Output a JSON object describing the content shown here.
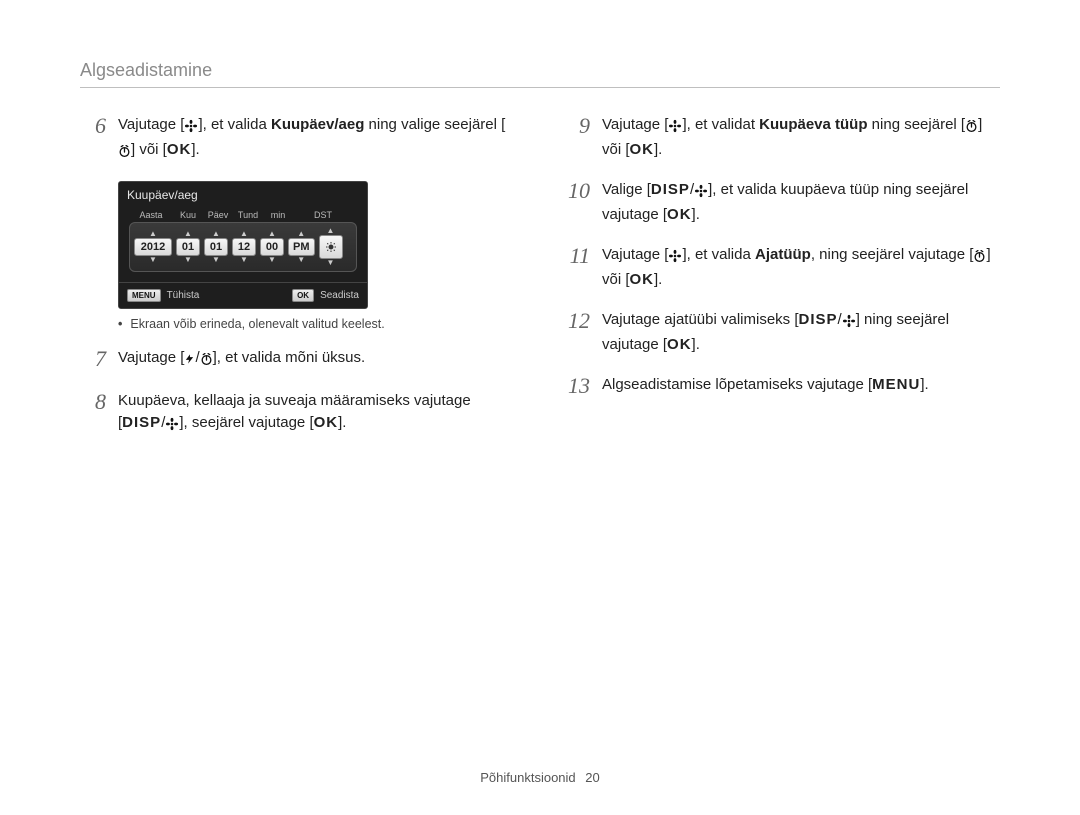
{
  "header": {
    "title": "Algseadistamine"
  },
  "lcd": {
    "title": "Kuupäev/aeg",
    "labels": {
      "year": "Aasta",
      "month": "Kuu",
      "day": "Päev",
      "hour": "Tund",
      "min": "min",
      "dst": "DST"
    },
    "values": {
      "year": "2012",
      "month": "01",
      "day": "01",
      "hour": "12",
      "min": "00",
      "ampm": "PM"
    },
    "footer": {
      "leftKey": "MENU",
      "leftLabel": "Tühista",
      "rightKey": "OK",
      "rightLabel": "Seadista"
    }
  },
  "left": {
    "step6_a": "Vajutage [",
    "step6_b": "], et valida ",
    "step6_bold": "Kuupäev/aeg",
    "step6_c": " ning valige seejärel [",
    "step6_d": "] või [",
    "step6_ok": "OK",
    "step6_e": "].",
    "note": "Ekraan võib erineda, olenevalt valitud keelest.",
    "step7_a": "Vajutage [",
    "step7_b": "/",
    "step7_c": "], et valida mõni üksus.",
    "step8_a": "Kuupäeva, kellaaja ja suveaja määramiseks vajutage [",
    "step8_disp": "DISP",
    "step8_b": "/",
    "step8_c": "], seejärel vajutage [",
    "step8_ok": "OK",
    "step8_d": "]."
  },
  "right": {
    "s9_a": "Vajutage [",
    "s9_b": "], et validat ",
    "s9_bold": "Kuupäeva tüüp",
    "s9_c": " ning seejärel [",
    "s9_d": "] või [",
    "s9_ok": "OK",
    "s9_e": "].",
    "s10_a": "Valige [",
    "s10_disp": "DISP",
    "s10_b": "/",
    "s10_c": "], et valida kuupäeva tüüp ning seejärel vajutage [",
    "s10_ok": "OK",
    "s10_d": "].",
    "s11_a": "Vajutage [",
    "s11_b": "], et valida ",
    "s11_bold": "Ajatüüp",
    "s11_c": ", ning seejärel vajutage [",
    "s11_d": "] või [",
    "s11_ok": "OK",
    "s11_e": "].",
    "s12_a": "Vajutage ajatüübi valimiseks [",
    "s12_disp": "DISP",
    "s12_b": "/",
    "s12_c": "] ning seejärel vajutage [",
    "s12_ok": "OK",
    "s12_d": "].",
    "s13_a": "Algseadistamise lõpetamiseks vajutage [",
    "s13_menu": "MENU",
    "s13_b": "]."
  },
  "nums": {
    "n6": "6",
    "n7": "7",
    "n8": "8",
    "n9": "9",
    "n10": "10",
    "n11": "11",
    "n12": "12",
    "n13": "13"
  },
  "footer": {
    "section": "Põhifunktsioonid",
    "page": "20"
  }
}
